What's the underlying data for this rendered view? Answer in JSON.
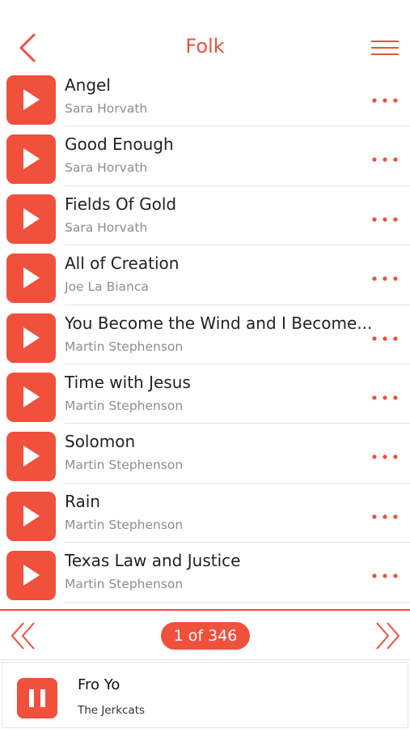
{
  "header": {
    "title": "Folk",
    "back_icon": "chevron-left-icon",
    "menu_icon": "hamburger-menu-icon"
  },
  "tracks": [
    {
      "title": "Angel",
      "artist": "Sara Horvath"
    },
    {
      "title": "Good Enough",
      "artist": "Sara Horvath"
    },
    {
      "title": "Fields Of Gold",
      "artist": "Sara Horvath"
    },
    {
      "title": "All of Creation",
      "artist": "Joe La Bianca"
    },
    {
      "title": "You Become the Wind and I Become...",
      "artist": "Martin Stephenson"
    },
    {
      "title": "Time with Jesus",
      "artist": "Martin Stephenson"
    },
    {
      "title": "Solomon",
      "artist": "Martin Stephenson"
    },
    {
      "title": "Rain",
      "artist": "Martin Stephenson"
    },
    {
      "title": "Texas Law and Justice",
      "artist": "Martin Stephenson"
    }
  ],
  "pager": {
    "label": "1 of 346",
    "prev_icon": "double-chevron-left-icon",
    "next_icon": "double-chevron-right-icon"
  },
  "now_playing": {
    "title": "Fro Yo",
    "artist": "The Jerkcats",
    "control_icon": "pause-icon"
  },
  "colors": {
    "accent": "#f0503c",
    "text_primary": "#222222",
    "text_secondary": "#8e8e8e",
    "divider": "#e3e3e3"
  }
}
